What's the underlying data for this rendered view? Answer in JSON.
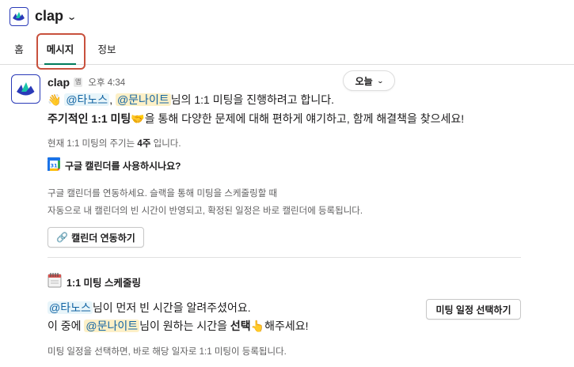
{
  "app": {
    "title": "clap",
    "brand_color": "#2a3ab8",
    "accent_green": "#007a5a",
    "highlight_color": "#c8513d"
  },
  "tabs": [
    {
      "label": "홈",
      "active": false
    },
    {
      "label": "메시지",
      "active": true
    },
    {
      "label": "정보",
      "active": false
    }
  ],
  "message": {
    "sender": "clap",
    "badge": "앱",
    "time": "오후 4:34",
    "date_divider": "오늘",
    "greeting_emoji": "👋",
    "mention_1": "@타노스",
    "comma": ",",
    "mention_2": "@문나이트",
    "line1_rest": "님의 1:1 미팅을 진행하려고 합니다.",
    "line2_bold": "주기적인 1:1 미팅",
    "line2_emoji": "🤝",
    "line2_rest": "을 통해 다양한 문제에 대해 편하게 얘기하고, 함께 해결책을 찾으세요!",
    "cycle_prefix": "현재 1:1 미팅의 주기는",
    "cycle_value": "4주",
    "cycle_suffix": "입니다.",
    "gcal_question": "구글 캘린더를 사용하시나요?",
    "gcal_desc_1": "구글 캘린더를 연동하세요. 슬랙을 통해 미팅을 스케줄링할 때",
    "gcal_desc_2": "자동으로 내 캘린더의 빈 시간이 반영되고, 확정된 일정은 바로 캘린더에 등록됩니다.",
    "link_emoji": "🔗",
    "connect_button": "캘린더 연동하기",
    "sched_title": "1:1 미팅 스케줄링",
    "sched_line1_mention": "@타노스",
    "sched_line1_rest": "님이 먼저 빈 시간을 알려주셨어요.",
    "sched_line2_prefix": "이 중에",
    "sched_line2_mention": "@문나이트",
    "sched_line2_mid": "님이 원하는 시간을",
    "sched_line2_bold": "선택",
    "sched_line2_emoji": "👆",
    "sched_line2_suffix": "해주세요!",
    "select_button": "미팅 일정 선택하기",
    "footer_note": "미팅 일정을 선택하면, 바로 해당 일자로 1:1 미팅이 등록됩니다."
  },
  "icons": {
    "app_logo": "clap-logo-icon",
    "calendar": "google-calendar-icon",
    "sched": "spiral-calendar-icon",
    "link": "link-icon"
  }
}
